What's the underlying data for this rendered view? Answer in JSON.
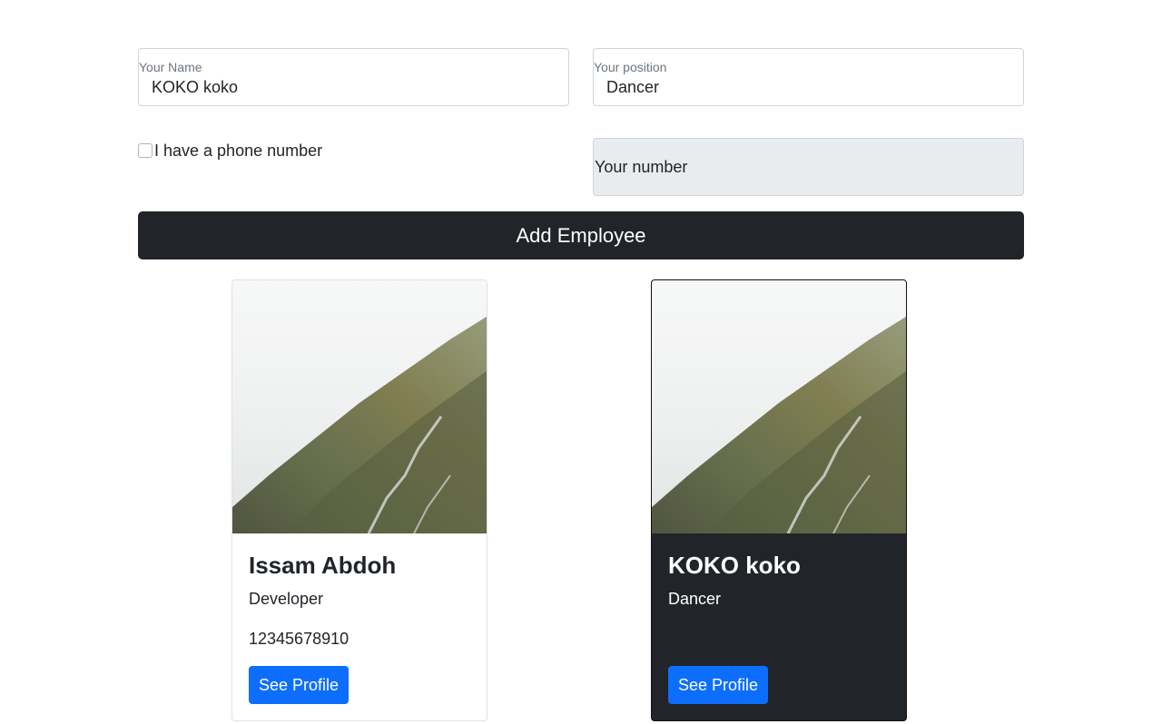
{
  "form": {
    "name_label": "Your Name",
    "name_value": "KOKO koko",
    "position_label": "Your position",
    "position_value": "Dancer",
    "phone_checkbox_label": "I have a phone number",
    "phone_checked": false,
    "number_placeholder": "Your number",
    "add_button_label": "Add Employee"
  },
  "employees": [
    {
      "name": "Issam Abdoh",
      "position": "Developer",
      "phone": "12345678910",
      "button_label": "See Profile",
      "theme": "light"
    },
    {
      "name": "KOKO koko",
      "position": "Dancer",
      "phone": "",
      "button_label": "See Profile",
      "theme": "dark"
    }
  ],
  "colors": {
    "primary_button": "#0d6efd",
    "dark_bg": "#212529",
    "disabled_field": "#e9ecef"
  }
}
